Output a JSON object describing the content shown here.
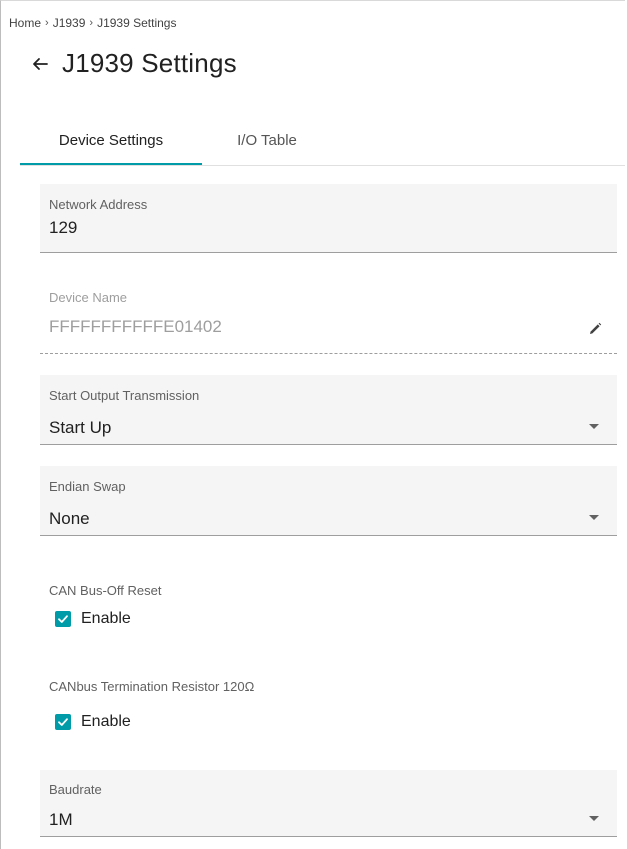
{
  "breadcrumb": {
    "items": [
      "Home",
      "J1939",
      "J1939 Settings"
    ],
    "separator": "›"
  },
  "page": {
    "title": "J1939 Settings",
    "back_icon": "arrow-left-icon"
  },
  "tabs": [
    {
      "label": "Device Settings",
      "active": true
    },
    {
      "label": "I/O Table",
      "active": false
    }
  ],
  "fields": {
    "network_address": {
      "label": "Network Address",
      "value": "129"
    },
    "device_name": {
      "label": "Device Name",
      "value": "FFFFFFFFFFFE01402",
      "icon": "pencil-icon",
      "disabled": true
    },
    "start_output": {
      "label": "Start Output Transmission",
      "value": "Start Up"
    },
    "endian_swap": {
      "label": "Endian Swap",
      "value": "None"
    },
    "baudrate": {
      "label": "Baudrate",
      "value": "1M"
    }
  },
  "can_bus_off_reset": {
    "label": "CAN Bus-Off Reset",
    "checkbox_label": "Enable",
    "checked": true
  },
  "termination_resistor": {
    "label": "CANbus Termination Resistor 120Ω",
    "checkbox_label": "Enable",
    "checked": true
  },
  "colors": {
    "accent": "#009ba8",
    "field_bg": "#f5f5f5"
  }
}
